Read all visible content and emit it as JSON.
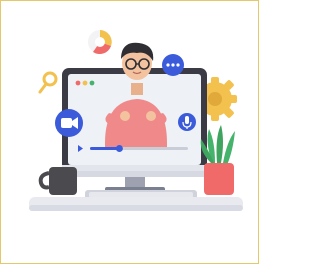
{
  "illustration": {
    "subject": "video-call-on-monitor",
    "icons": [
      "pie-chart-icon",
      "magnifier-icon",
      "chat-bubble-icon",
      "gear-icon",
      "video-camera-icon",
      "microphone-icon"
    ],
    "progress_fraction": 0.3,
    "colors": {
      "frame_border": "#e3c96a",
      "monitor": "#3a3b45",
      "screen": "#eef1f6",
      "shirt": "#f08a8a",
      "skin": "#f3c3a0",
      "hair": "#2f2f33",
      "blue_accent": "#3b5bdb",
      "gear": "#f2c14e",
      "plant": "#45b36b",
      "pot": "#f06a6a",
      "mug": "#4a4a4f",
      "desk": "#e8eaf0"
    }
  }
}
